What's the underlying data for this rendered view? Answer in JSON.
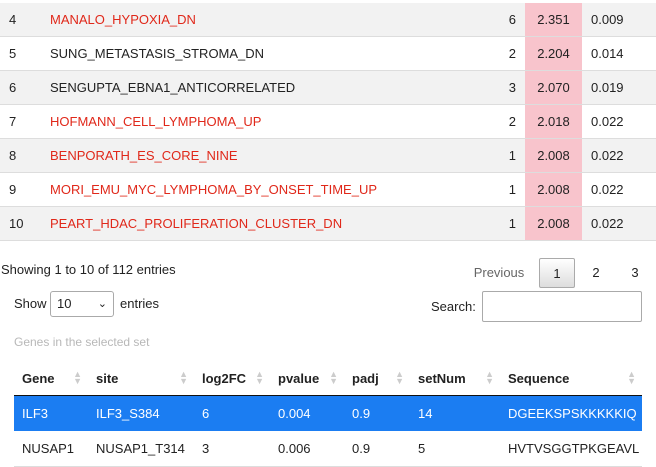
{
  "top_table": {
    "rows": [
      {
        "idx": "4",
        "name": "MANALO_HYPOXIA_DN",
        "red": true,
        "n": "6",
        "score": "2.351",
        "p": "0.009"
      },
      {
        "idx": "5",
        "name": "SUNG_METASTASIS_STROMA_DN",
        "red": false,
        "n": "2",
        "score": "2.204",
        "p": "0.014"
      },
      {
        "idx": "6",
        "name": "SENGUPTA_EBNA1_ANTICORRELATED",
        "red": false,
        "n": "3",
        "score": "2.070",
        "p": "0.019"
      },
      {
        "idx": "7",
        "name": "HOFMANN_CELL_LYMPHOMA_UP",
        "red": true,
        "n": "2",
        "score": "2.018",
        "p": "0.022"
      },
      {
        "idx": "8",
        "name": "BENPORATH_ES_CORE_NINE",
        "red": true,
        "n": "1",
        "score": "2.008",
        "p": "0.022"
      },
      {
        "idx": "9",
        "name": "MORI_EMU_MYC_LYMPHOMA_BY_ONSET_TIME_UP",
        "red": true,
        "n": "1",
        "score": "2.008",
        "p": "0.022"
      },
      {
        "idx": "10",
        "name": "PEART_HDAC_PROLIFERATION_CLUSTER_DN",
        "red": true,
        "n": "1",
        "score": "2.008",
        "p": "0.022"
      }
    ]
  },
  "info": "Showing 1 to 10 of 112 entries",
  "pagination": {
    "previous": "Previous",
    "current": "1",
    "page2": "2",
    "page3": "3"
  },
  "length": {
    "show_label": "Show",
    "value": "10",
    "entries_label": "entries"
  },
  "search": {
    "label": "Search:",
    "value": ""
  },
  "genes_title": "Genes in the selected set",
  "genes_table": {
    "headers": [
      "Gene",
      "site",
      "log2FC",
      "pvalue",
      "padj",
      "setNum",
      "Sequence"
    ],
    "rows": [
      [
        "ILF3",
        "ILF3_S384",
        "6",
        "0.004",
        "0.9",
        "14",
        "DGEEKSPSKKKKKIQ"
      ],
      [
        "NUSAP1",
        "NUSAP1_T314",
        "3",
        "0.006",
        "0.9",
        "5",
        "HVTVSGGTPKGEAVL"
      ]
    ]
  },
  "colors": {
    "score_highlight": "#f8c4cc",
    "link_red": "#e0281a",
    "selected_row": "#1b7df2"
  }
}
